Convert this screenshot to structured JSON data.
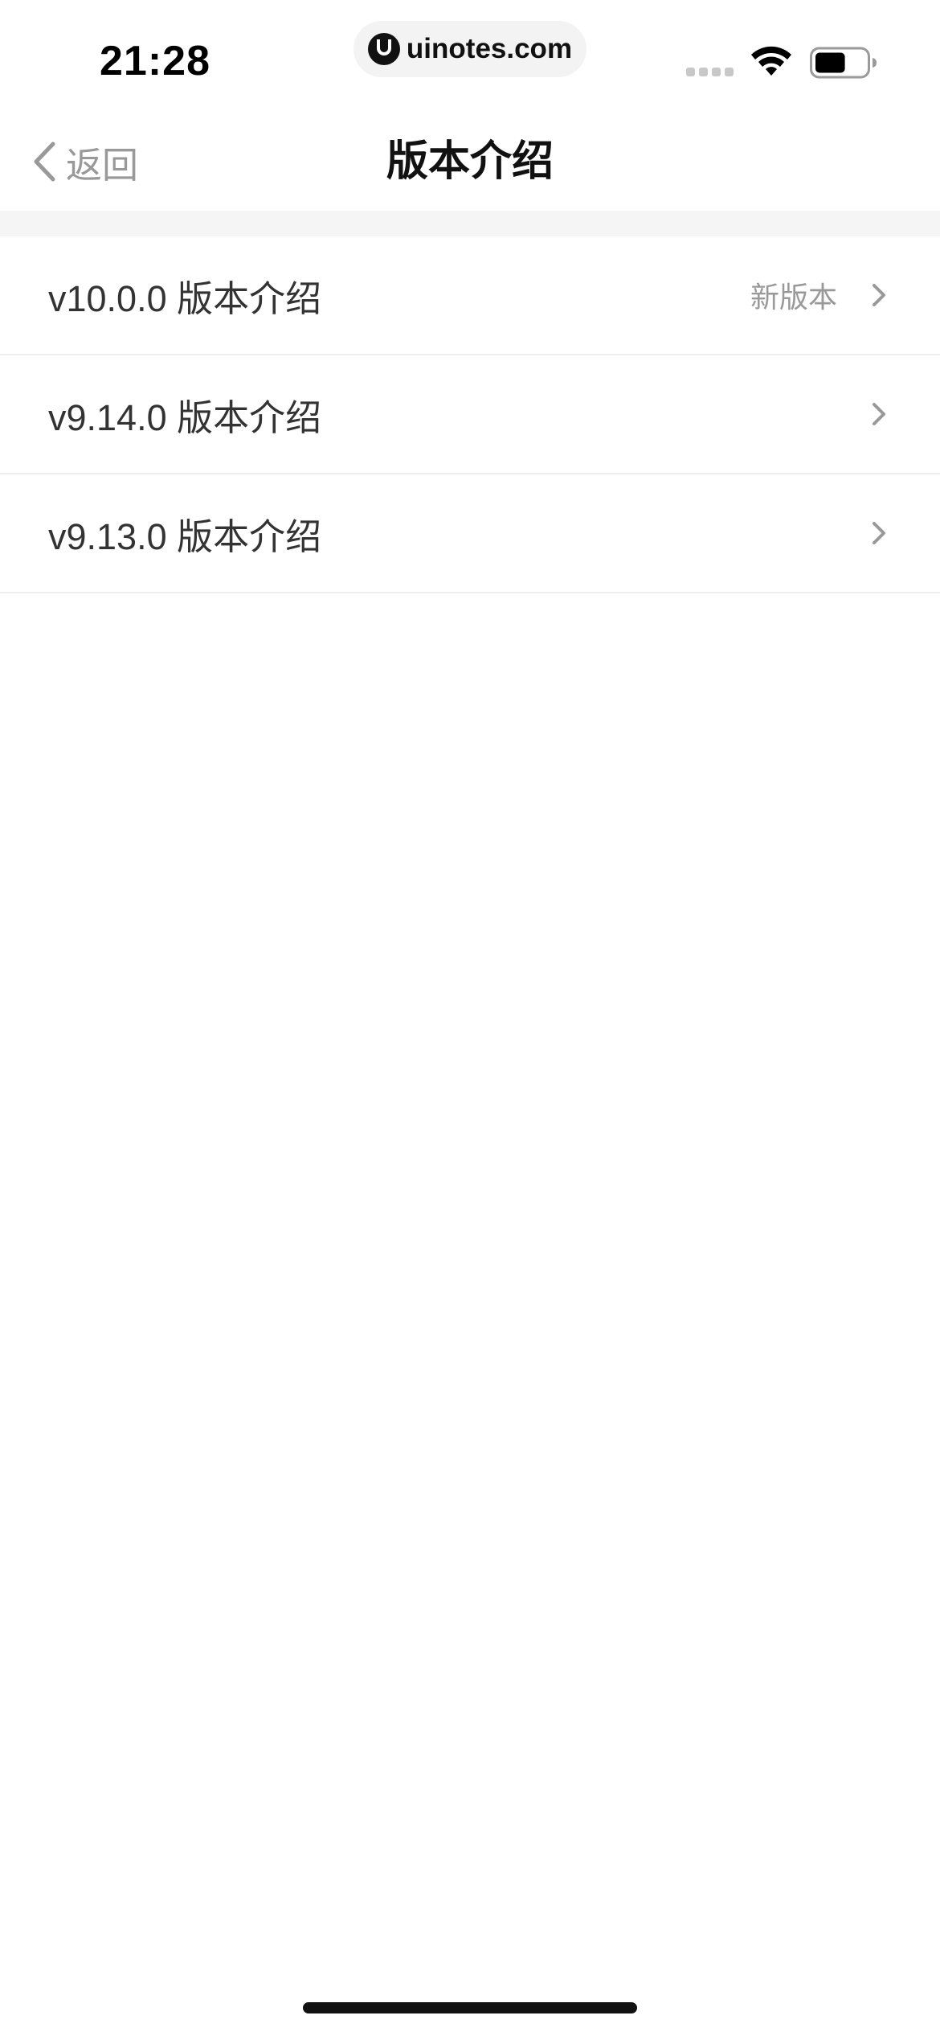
{
  "status_bar": {
    "time": "21:28",
    "url": "uinotes.com",
    "battery_level": 0.6
  },
  "nav": {
    "back_label": "返回",
    "title": "版本介绍"
  },
  "versions": [
    {
      "label": "v10.0.0 版本介绍",
      "badge": "新版本"
    },
    {
      "label": "v9.14.0 版本介绍",
      "badge": ""
    },
    {
      "label": "v9.13.0 版本介绍",
      "badge": ""
    }
  ],
  "colors": {
    "text_primary": "#333333",
    "text_secondary": "#999999",
    "divider": "#eeeeee",
    "section_background": "#f5f5f5"
  },
  "icons": {
    "back": "chevron-left-icon",
    "row_arrow": "chevron-right-icon",
    "wifi": "wifi-icon",
    "battery": "battery-icon",
    "signal": "cellular-signal-icon",
    "site_logo": "uinotes-logo-icon"
  }
}
